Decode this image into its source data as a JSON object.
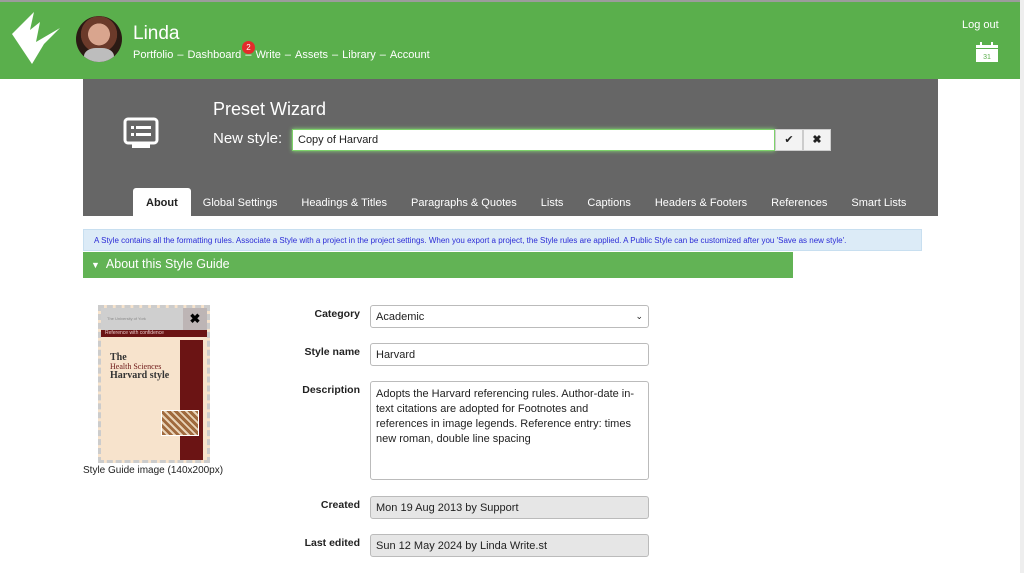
{
  "header": {
    "user_name": "Linda",
    "nav": [
      "Portfolio",
      "Dashboard",
      "Write",
      "Assets",
      "Library",
      "Account"
    ],
    "nav_separator": "–",
    "dashboard_badge": "2",
    "logout": "Log out",
    "calendar_day": "31",
    "brand_color": "#5aaf4c"
  },
  "wizard": {
    "title": "Preset Wizard",
    "new_style_label": "New style:",
    "new_style_value": "Copy of Harvard",
    "confirm_icon": "check-icon",
    "cancel_icon": "close-icon"
  },
  "tabs": [
    "About",
    "Global Settings",
    "Headings & Titles",
    "Paragraphs & Quotes",
    "Lists",
    "Captions",
    "Headers & Footers",
    "References",
    "Smart Lists"
  ],
  "info": "A Style contains all the formatting rules. Associate a Style with a project in the project settings. When you export a project, the Style rules are applied. A Public Style can be customized after you 'Save as new style'.",
  "section_title": "About this Style Guide",
  "image": {
    "caption": "Style Guide image (140x200px)",
    "cover_text": [
      "The University of York",
      "Reference with confidence",
      "The",
      "Health Sciences",
      "Harvard style"
    ]
  },
  "form": {
    "category_label": "Category",
    "category_value": "Academic",
    "style_name_label": "Style name",
    "style_name_value": "Harvard",
    "description_label": "Description",
    "description_value": "Adopts the Harvard referencing rules. Author-date in-text citations are adopted for Footnotes and references in image legends. Reference entry: times new roman, double line spacing",
    "created_label": "Created",
    "created_value": "Mon 19 Aug 2013 by Support",
    "edited_label": "Last edited",
    "edited_value": "Sun 12 May 2024 by Linda Write.st"
  }
}
